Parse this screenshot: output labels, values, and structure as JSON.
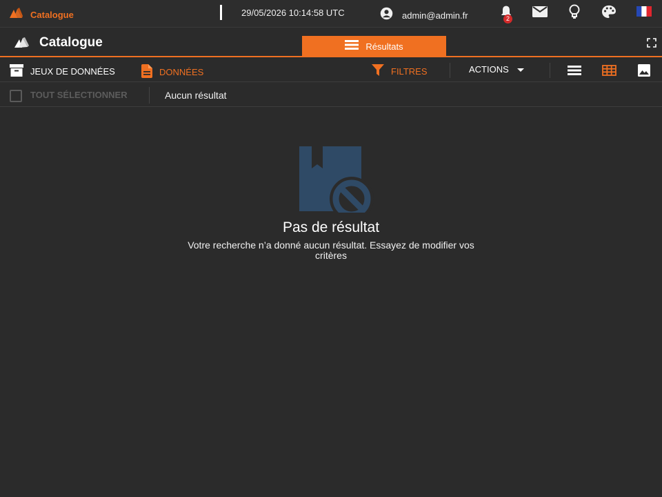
{
  "topbar": {
    "app_name": "Catalogue",
    "clock": "29/05/2026 10:14:58 UTC",
    "user_email": "admin@admin.fr",
    "notifications_count": "2",
    "icons": [
      "user-circle-icon",
      "bell-icon",
      "mail-icon",
      "lightbulb-icon",
      "palette-icon",
      "french-flag-icon"
    ]
  },
  "header": {
    "title": "Catalogue",
    "tab_label": "Résultats"
  },
  "toolbar": {
    "datasets_label": "JEUX DE DONNÉES",
    "data_label": "DONNÉES",
    "filters_label": "FILTRES",
    "actions_label": "ACTIONS"
  },
  "selection": {
    "select_all_label": "TOUT SÉLECTIONNER",
    "result_count": "Aucun résultat"
  },
  "empty_state": {
    "title": "Pas de résultat",
    "description": "Votre recherche n’a donné aucun résultat. Essayez de modifier vos critères"
  },
  "colors": {
    "accent": "#f07021",
    "background": "#2b2b2b",
    "empty_icon": "#2f4a66"
  }
}
